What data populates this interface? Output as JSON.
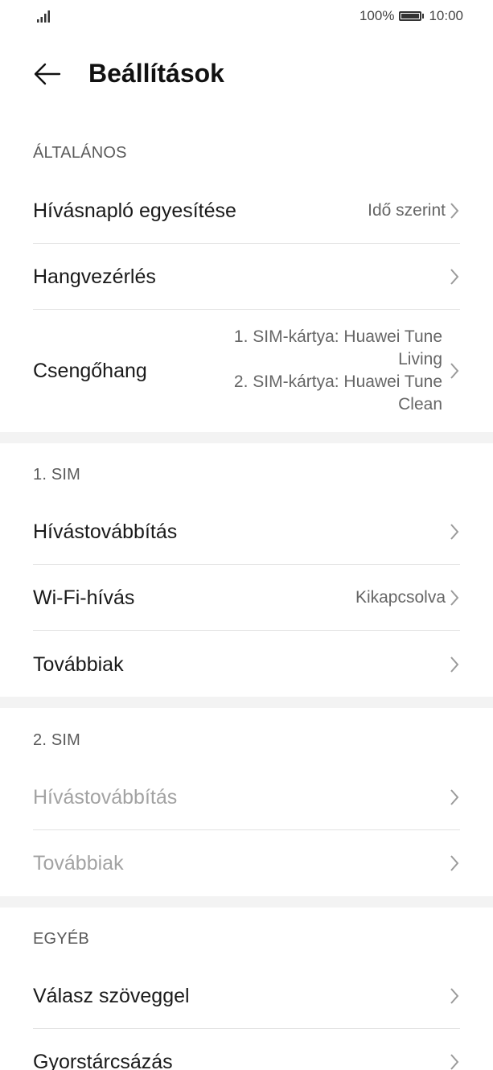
{
  "status": {
    "battery_percent": "100%",
    "time": "10:00"
  },
  "header": {
    "title": "Beállítások",
    "back_icon": "arrow-left-icon"
  },
  "sections": {
    "general": {
      "header": "ÁLTALÁNOS",
      "call_log_merge": {
        "label": "Hívásnapló egyesítése",
        "value": "Idő szerint"
      },
      "voice_control": {
        "label": "Hangvezérlés"
      },
      "ringtone": {
        "label": "Csengőhang",
        "sim1_line1": "1. SIM-kártya: Huawei Tune",
        "sim1_line2": "Living",
        "sim2_line1": "2. SIM-kártya: Huawei Tune",
        "sim2_line2": "Clean"
      }
    },
    "sim1": {
      "header": "1. SIM",
      "call_forwarding": {
        "label": "Hívástovábbítás"
      },
      "wifi_calling": {
        "label": "Wi-Fi-hívás",
        "value": "Kikapcsolva"
      },
      "more": {
        "label": "Továbbiak"
      }
    },
    "sim2": {
      "header": "2. SIM",
      "call_forwarding": {
        "label": "Hívástovábbítás"
      },
      "more": {
        "label": "Továbbiak"
      }
    },
    "other": {
      "header": "EGYÉB",
      "reply_with_text": {
        "label": "Válasz szöveggel"
      },
      "speed_dial": {
        "label": "Gyorstárcsázás"
      }
    }
  }
}
